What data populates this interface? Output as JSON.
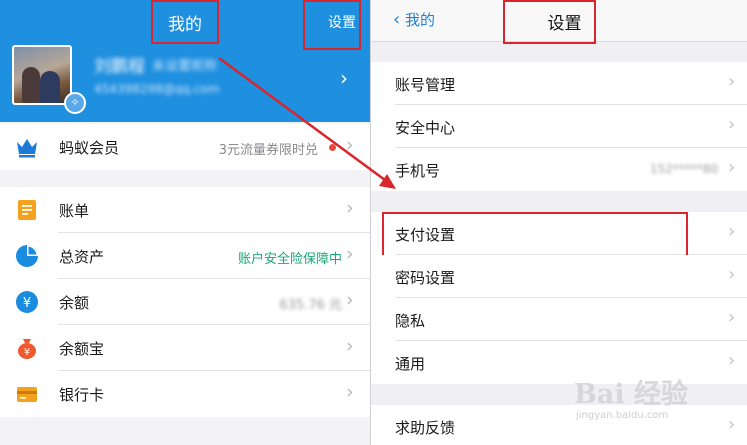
{
  "left": {
    "title": "我的",
    "settings": "设置",
    "user": {
      "name": "刘鹏程",
      "status": "未设置昵称",
      "email": "454398298@qq.com"
    },
    "member": {
      "label": "蚂蚁会员",
      "note": "3元流量券限时兑"
    },
    "items": [
      {
        "label": "账单",
        "note": "",
        "icon": "bill-icon"
      },
      {
        "label": "总资产",
        "note": "账户安全险保障中",
        "icon": "pie-chart-icon"
      },
      {
        "label": "余额",
        "note": "635.76 元",
        "icon": "yuan-icon"
      },
      {
        "label": "余额宝",
        "note": "",
        "icon": "money-bag-icon"
      },
      {
        "label": "银行卡",
        "note": "",
        "icon": "bank-card-icon"
      }
    ]
  },
  "right": {
    "back": "我的",
    "title": "设置",
    "rows": [
      {
        "label": "账号管理",
        "value": ""
      },
      {
        "label": "安全中心",
        "value": ""
      },
      {
        "label": "手机号",
        "value": "152*****80"
      },
      {
        "label": "支付设置",
        "value": ""
      },
      {
        "label": "密码设置",
        "value": ""
      },
      {
        "label": "隐私",
        "value": ""
      },
      {
        "label": "通用",
        "value": ""
      },
      {
        "label": "求助反馈",
        "value": ""
      }
    ]
  },
  "watermark": {
    "text": "Bai 经验",
    "url": "jingyan.baidu.com"
  },
  "colors": {
    "header_blue": "#1f8fe0",
    "highlight_red": "#d8262c",
    "link_blue": "#2580d5",
    "green_note": "#1ba57a"
  }
}
